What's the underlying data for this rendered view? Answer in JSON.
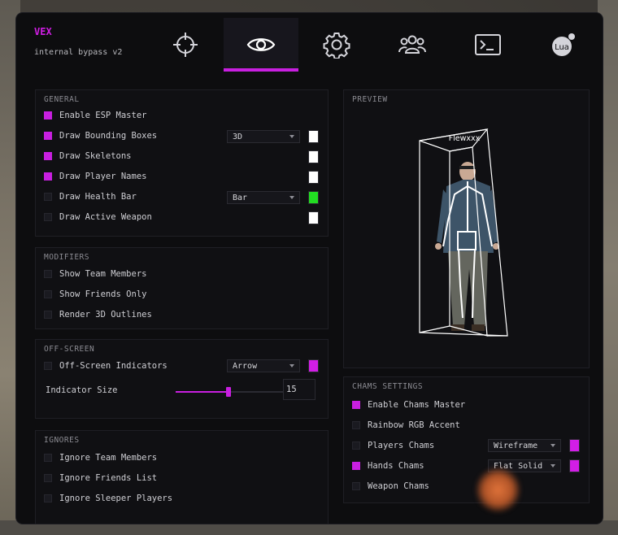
{
  "brand": {
    "name": "VEX",
    "subtitle": "internal bypass v2"
  },
  "tabs": [
    {
      "icon": "crosshair-icon",
      "active": false
    },
    {
      "icon": "eye-icon",
      "active": true
    },
    {
      "icon": "gear-icon",
      "active": false
    },
    {
      "icon": "users-icon",
      "active": false
    },
    {
      "icon": "terminal-icon",
      "active": false
    },
    {
      "icon": "lua-icon",
      "label": "Lua",
      "active": false
    }
  ],
  "colors": {
    "accent": "#c81fe0",
    "white_swatch": "#ffffff",
    "green_swatch": "#22dd22",
    "magenta_swatch": "#d21ee6"
  },
  "general": {
    "title": "GENERAL",
    "items": [
      {
        "label": "Enable ESP Master",
        "checked": true
      },
      {
        "label": "Draw Bounding Boxes",
        "checked": true,
        "select": "3D",
        "color": "#ffffff"
      },
      {
        "label": "Draw Skeletons",
        "checked": true,
        "color": "#ffffff"
      },
      {
        "label": "Draw Player Names",
        "checked": true,
        "color": "#ffffff"
      },
      {
        "label": "Draw Health Bar",
        "checked": false,
        "select": "Bar",
        "color": "#22dd22"
      },
      {
        "label": "Draw Active Weapon",
        "checked": false,
        "color": "#ffffff"
      }
    ]
  },
  "modifiers": {
    "title": "MODIFIERS",
    "items": [
      {
        "label": "Show Team Members",
        "checked": false
      },
      {
        "label": "Show Friends Only",
        "checked": false
      },
      {
        "label": "Render 3D Outlines",
        "checked": false
      }
    ]
  },
  "offscreen": {
    "title": "OFF-SCREEN",
    "indicators": {
      "label": "Off-Screen Indicators",
      "checked": false,
      "select": "Arrow",
      "color": "#d21ee6"
    },
    "size": {
      "label": "Indicator Size",
      "value": "15",
      "fraction": 0.43
    }
  },
  "ignores": {
    "title": "IGNORES",
    "items": [
      {
        "label": "Ignore Team Members",
        "checked": false
      },
      {
        "label": "Ignore Friends List",
        "checked": false
      },
      {
        "label": "Ignore Sleeper Players",
        "checked": false
      }
    ]
  },
  "preview": {
    "title": "PREVIEW",
    "player_name": "Flewxxx"
  },
  "chams": {
    "title": "CHAMS SETTINGS",
    "items": [
      {
        "label": "Enable Chams Master",
        "checked": true
      },
      {
        "label": "Rainbow RGB Accent",
        "checked": false
      },
      {
        "label": "Players Chams",
        "checked": false,
        "select": "Wireframe",
        "color": "#d21ee6"
      },
      {
        "label": "Hands Chams",
        "checked": true,
        "select": "Flat Solid",
        "color": "#d21ee6"
      },
      {
        "label": "Weapon Chams",
        "checked": false
      }
    ]
  }
}
